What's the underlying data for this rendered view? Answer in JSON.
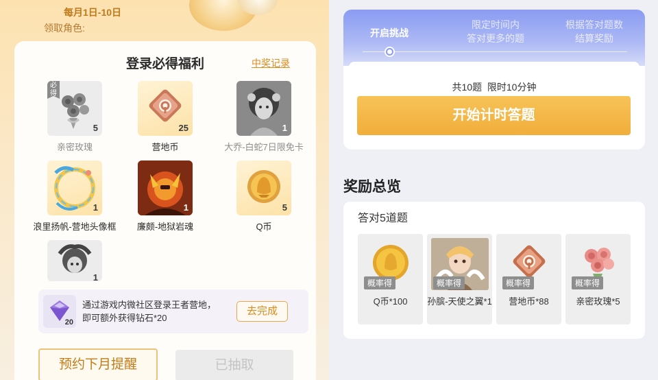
{
  "left": {
    "date_text": "每月1日-10日",
    "role_label": "领取角色:",
    "card": {
      "title": "登录必得福利",
      "record_link": "中奖记录",
      "items": [
        {
          "name": "亲密玫瑰",
          "count": "5",
          "tag": "必得",
          "icon": "rose-bouquet-icon"
        },
        {
          "name": "营地币",
          "count": "25",
          "icon": "camp-coin-icon"
        },
        {
          "name": "大乔-白蛇7日限免卡",
          "count": "1",
          "icon": "daqiao-skin-portrait"
        },
        {
          "name": "浪里扬帆-营地头像框",
          "count": "1",
          "icon": "avatar-frame-icon"
        },
        {
          "name": "廉颇-地狱岩魂",
          "count": "1",
          "icon": "lianpo-skin-portrait"
        },
        {
          "name": "Q币",
          "count": "5",
          "icon": "q-coin-icon"
        },
        {
          "name": "",
          "count": "1",
          "icon": "character-portrait"
        }
      ],
      "task": {
        "text": "通过游戏内微社区登录王者营地，即可额外获得钻石*20",
        "gem_count": "20",
        "icon": "diamond-icon",
        "button": "去完成"
      },
      "reserve_button": "预约下月提醒",
      "claimed_button": "已抽取"
    }
  },
  "right": {
    "steps": [
      {
        "label": "开启挑战",
        "active": true
      },
      {
        "label": "限定时间内\n答对更多的题",
        "active": false
      },
      {
        "label": "根据答对题数\n结算奖励",
        "active": false
      }
    ],
    "quiz_info": "共10题  限时10分钟",
    "start_button": "开始计时答题",
    "section_title": "奖励总览",
    "reward": {
      "subtitle": "答对5道题",
      "badge": "概率得",
      "items": [
        {
          "name": "Q币*100",
          "icon": "q-coin-icon"
        },
        {
          "name": "孙膑-天使之翼*1",
          "icon": "sunbin-skin-portrait"
        },
        {
          "name": "营地币*88",
          "icon": "camp-coin-icon"
        },
        {
          "name": "亲密玫瑰*5",
          "icon": "rose-bouquet-icon"
        }
      ]
    }
  },
  "colors": {
    "accent_orange": "#e08a1e",
    "start_button": "#f1ae3b",
    "header_blue": "#8a9bf2"
  }
}
